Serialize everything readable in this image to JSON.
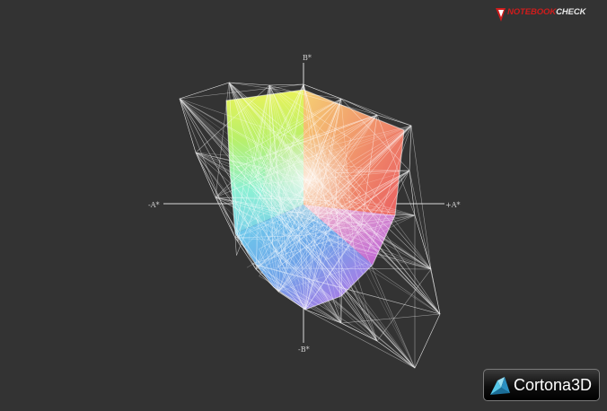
{
  "brand": {
    "logo_text_a": "NOTEBOOK",
    "logo_text_b": "CHECK",
    "accent_color": "#d01c1c"
  },
  "axes": {
    "b_positive": "B*",
    "b_negative": "-B*",
    "a_negative": "-A*",
    "a_positive": "+A*"
  },
  "viewer": {
    "badge_text": "Cortona3D",
    "badge_icon": "cortona-logo-icon"
  },
  "scene": {
    "background": "#333333",
    "solid_colors": [
      "#f2ea3a",
      "#e84f4f",
      "#c05ce0",
      "#5c8fe0",
      "#7ef0e6",
      "#9ef04a",
      "#ffffff"
    ],
    "wireframe_color": "#ffffff"
  }
}
